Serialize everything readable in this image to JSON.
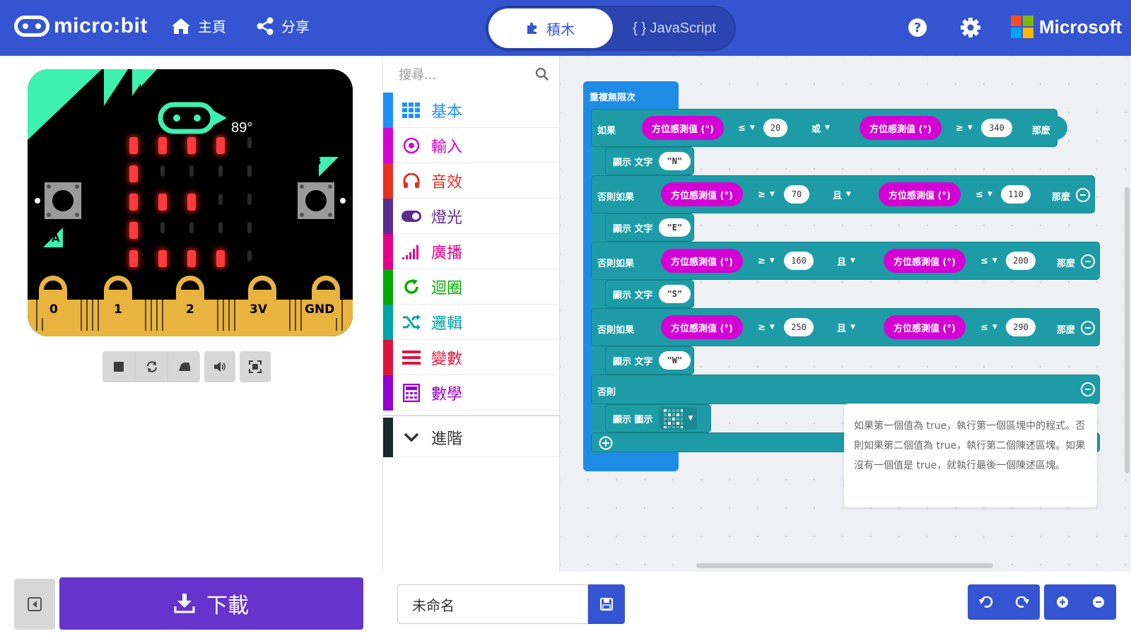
{
  "header": {
    "brand": "micro:bit",
    "nav_home": "主頁",
    "nav_share": "分享",
    "tab_blocks": "積木",
    "tab_js": "{ } JavaScript",
    "ms_brand": "Microsoft"
  },
  "simulator": {
    "compass_readout": "89°",
    "pin_labels": [
      "0",
      "1",
      "2",
      "3V",
      "GND"
    ],
    "button_a": "A",
    "button_b": "B",
    "led_matrix": [
      [
        1,
        1,
        1,
        1,
        0
      ],
      [
        1,
        0,
        0,
        0,
        0
      ],
      [
        1,
        1,
        1,
        0,
        0
      ],
      [
        1,
        0,
        0,
        0,
        0
      ],
      [
        1,
        1,
        1,
        1,
        0
      ]
    ]
  },
  "toolbox": {
    "search_placeholder": "搜尋...",
    "categories": [
      {
        "label": "基本",
        "color": "#1E90FF"
      },
      {
        "label": "輸入",
        "color": "#D400D4"
      },
      {
        "label": "音效",
        "color": "#E63022"
      },
      {
        "label": "燈光",
        "color": "#5C2D91"
      },
      {
        "label": "廣播",
        "color": "#E3008C"
      },
      {
        "label": "迴圈",
        "color": "#00AA00"
      },
      {
        "label": "邏輯",
        "color": "#00A4A6"
      },
      {
        "label": "變數",
        "color": "#DC143C"
      },
      {
        "label": "數學",
        "color": "#9400D3"
      }
    ],
    "advanced": "進階"
  },
  "workspace": {
    "forever": "重複無限次",
    "if": "如果",
    "elseif": "否則如果",
    "else": "否則",
    "then": "那麼",
    "compass": "方位感測值 (°)",
    "show_text": "顯示 文字",
    "show_icon": "顯示 圖示",
    "or": "或",
    "and": "且",
    "le": "≤",
    "ge": "≥",
    "cond": [
      {
        "a": "20",
        "b": "340",
        "text": "\"N\""
      },
      {
        "a": "70",
        "b": "110",
        "text": "\"E\""
      },
      {
        "a": "160",
        "b": "200",
        "text": "\"S\""
      },
      {
        "a": "250",
        "b": "290",
        "text": "\"W\""
      }
    ],
    "tooltip": "如果第一個值為 true，執行第一個區塊中的程式。否則如果第二個值為 true，執行第二個陳述區塊。如果沒有一個值是 true，就執行最後一個陳述區塊。"
  },
  "bottom": {
    "download": "下載",
    "project_name": "未命名"
  },
  "colors": {
    "header": "#3454D1",
    "download": "#6633CC",
    "logic": "#1D9CA7",
    "loop": "#1E8CE6",
    "input": "#D400D4"
  }
}
